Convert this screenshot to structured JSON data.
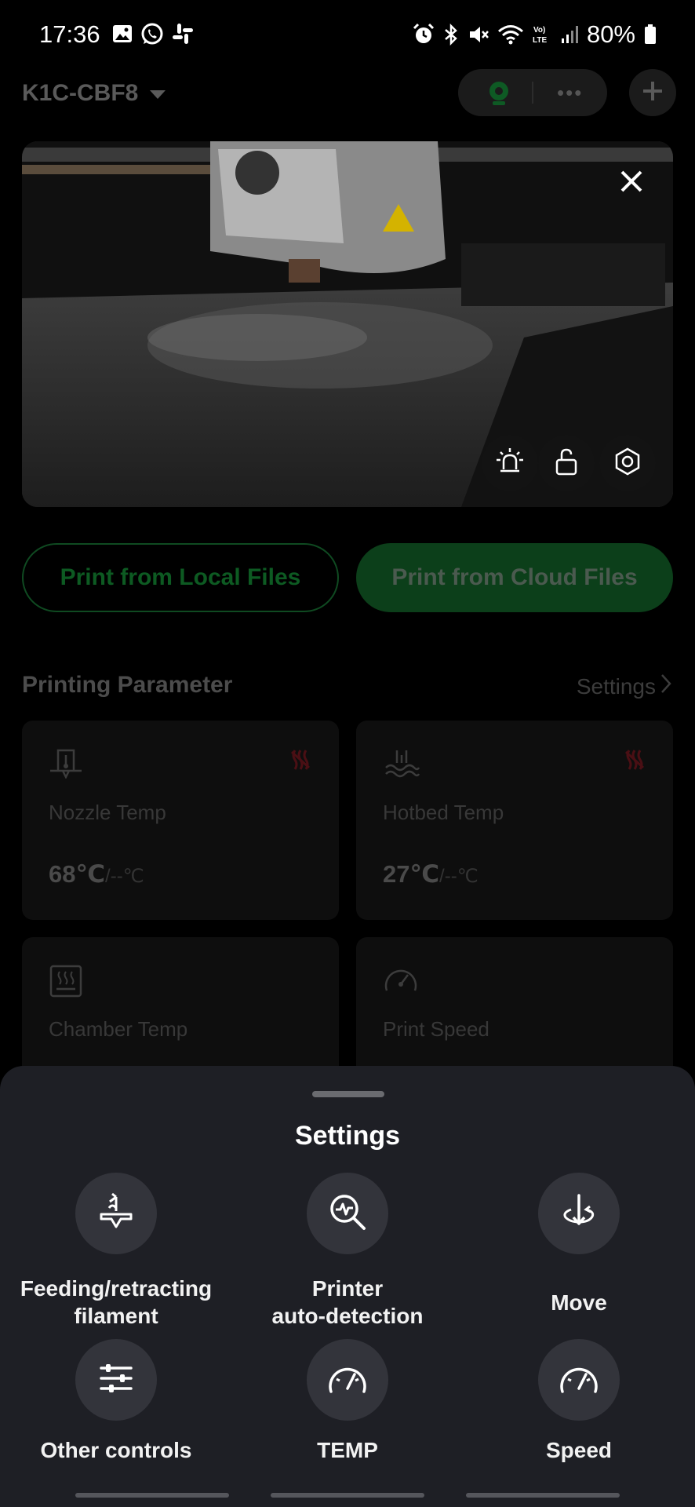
{
  "status_bar": {
    "time": "17:36",
    "battery": "80%"
  },
  "header": {
    "printer_name": "K1C-CBF8"
  },
  "actions": {
    "print_local": "Print from Local Files",
    "print_cloud": "Print from Cloud Files"
  },
  "params": {
    "title": "Printing Parameter",
    "settings_link": "Settings",
    "cards": [
      {
        "label": "Nozzle Temp",
        "value": "68℃",
        "target": "/--℃"
      },
      {
        "label": "Hotbed Temp",
        "value": "27℃",
        "target": "/--℃"
      },
      {
        "label": "Chamber Temp"
      },
      {
        "label": "Print Speed"
      }
    ]
  },
  "sheet": {
    "title": "Settings",
    "items": [
      {
        "label_line1": "Feeding/retracting",
        "label_line2": "filament",
        "icon": "filament-feed-icon"
      },
      {
        "label_line1": "Printer",
        "label_line2": "auto-detection",
        "icon": "auto-detection-icon"
      },
      {
        "label": "Move",
        "icon": "move-icon"
      },
      {
        "label": "Other controls",
        "icon": "sliders-icon"
      },
      {
        "label": "TEMP",
        "icon": "gauge-icon"
      },
      {
        "label": "Speed",
        "icon": "gauge-icon"
      }
    ]
  },
  "colors": {
    "accent_green": "#0c3f1a",
    "sheet_bg": "#1e1f25"
  }
}
